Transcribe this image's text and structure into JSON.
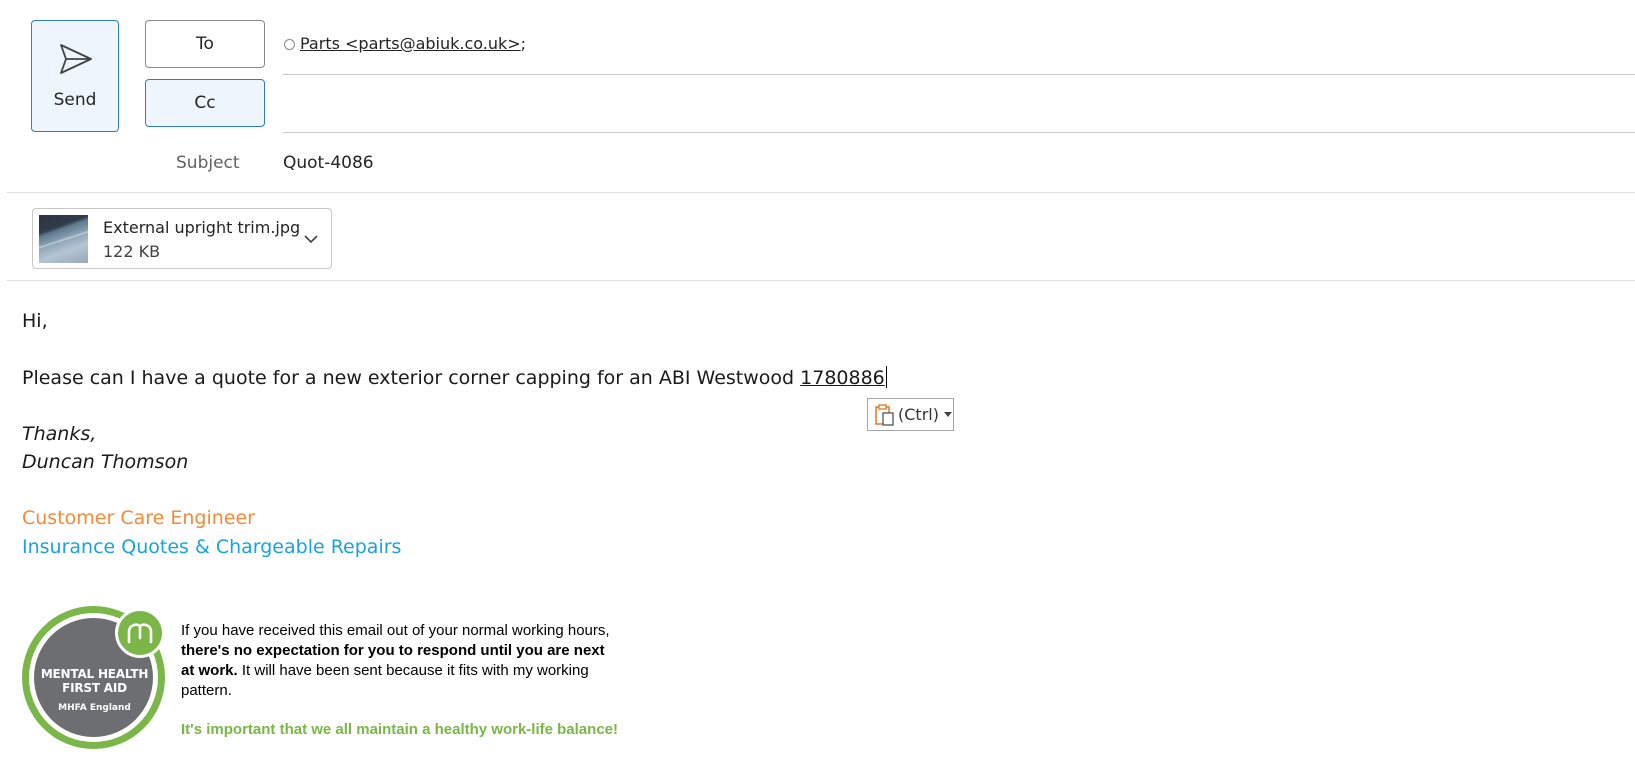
{
  "compose": {
    "send_label": "Send",
    "to_label": "To",
    "cc_label": "Cc",
    "to_recipient": "Parts <parts@abiuk.co.uk>",
    "to_separator": ";",
    "cc_value": "",
    "subject_label": "Subject",
    "subject_value": "Quot-4086"
  },
  "attachment": {
    "filename": "External upright trim.jpg",
    "size": "122 KB"
  },
  "body": {
    "greeting": "Hi,",
    "request_text": "Please can I have a quote for a new exterior corner capping for an ABI Westwood ",
    "request_ref": "1780886",
    "sign_off": "Thanks,",
    "signer_name": "Duncan Thomson",
    "role": "Customer Care Engineer",
    "department": "Insurance Quotes & Chargeable Repairs"
  },
  "paste_options": {
    "label": "(Ctrl)"
  },
  "signature": {
    "logo_text_line1": "MENTAL HEALTH",
    "logo_text_line2": "FIRST AID",
    "logo_text_line3": "MHFA England",
    "disclaimer_part1": "If you have received this email out of your normal working hours, ",
    "disclaimer_bold": "there's no expectation for you to respond until you are next at work.",
    "disclaimer_part2": " It will have been sent because it fits with my working pattern.",
    "balance_note": "It's important that we all maintain a healthy work-life balance!"
  },
  "colors": {
    "accent_blue": "#2f7cc0",
    "role_orange": "#f28a3a",
    "department_blue": "#1aa3d9",
    "mhfa_green": "#7ab648",
    "mhfa_grey": "#6d6e71"
  },
  "icons": {
    "send": "send-icon",
    "attachment_menu": "chevron-down-icon",
    "paste": "clipboard-icon",
    "presence": "presence-status-icon"
  }
}
